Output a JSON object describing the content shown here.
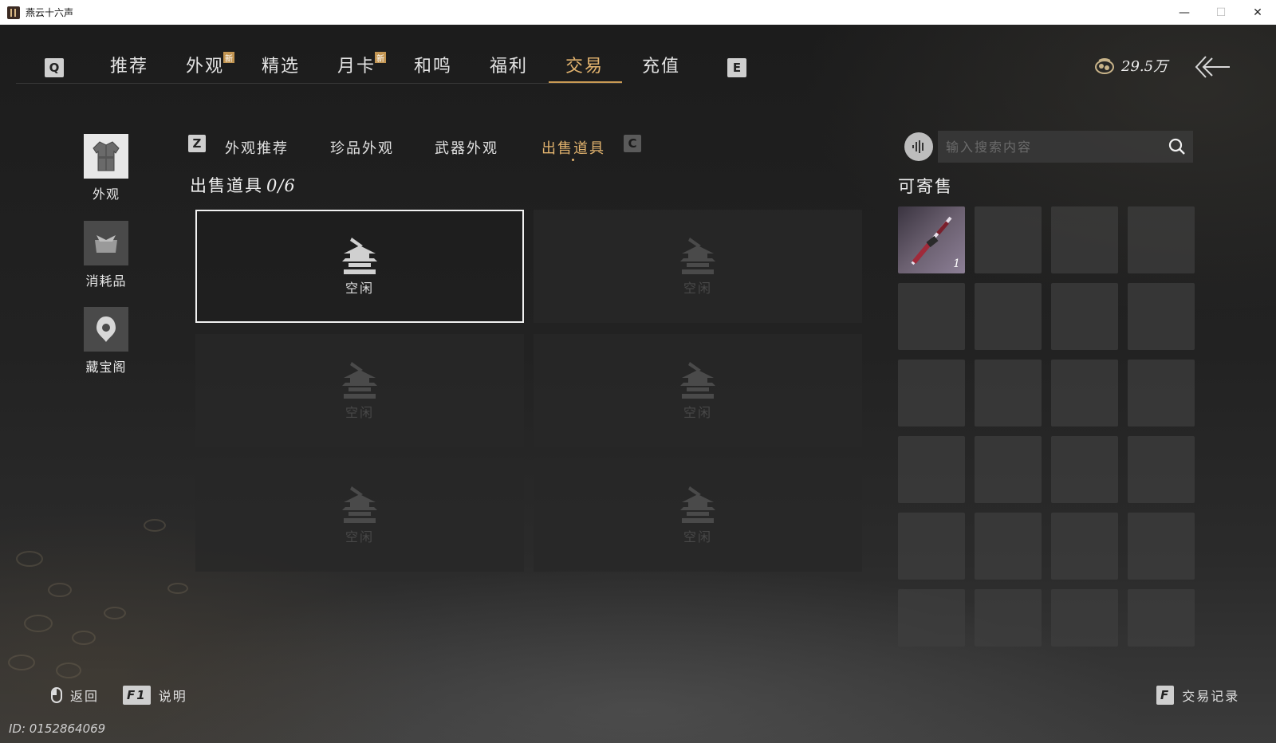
{
  "window": {
    "title": "燕云十六声",
    "minimize": "—",
    "maximize": "☐",
    "close": "✕"
  },
  "topnav": {
    "left_key": "Q",
    "right_key": "E",
    "tabs": [
      {
        "label": "推荐",
        "badge": ""
      },
      {
        "label": "外观",
        "badge": "新"
      },
      {
        "label": "精选",
        "badge": ""
      },
      {
        "label": "月卡",
        "badge": "新"
      },
      {
        "label": "和鸣",
        "badge": ""
      },
      {
        "label": "福利",
        "badge": ""
      },
      {
        "label": "交易",
        "badge": ""
      },
      {
        "label": "充值",
        "badge": ""
      }
    ],
    "active_tab": "交易",
    "currency": "29.5万",
    "accent_color": "#e2b36e"
  },
  "sidenav": {
    "items": [
      {
        "label": "外观",
        "icon": "robe-icon"
      },
      {
        "label": "消耗品",
        "icon": "pouch-icon"
      },
      {
        "label": "藏宝阁",
        "icon": "treasure-icon"
      }
    ],
    "active_item": "外观"
  },
  "subtabs": {
    "left_key": "Z",
    "right_key": "C",
    "items": [
      "外观推荐",
      "珍品外观",
      "武器外观",
      "出售道具"
    ],
    "active": "出售道具"
  },
  "sale": {
    "title": "出售道具",
    "count": "0/6",
    "slot_label": "空闲",
    "slots": [
      "空闲",
      "空闲",
      "空闲",
      "空闲",
      "空闲",
      "空闲"
    ]
  },
  "search": {
    "placeholder": "输入搜索内容",
    "value": ""
  },
  "consign": {
    "title": "可寄售",
    "items": [
      {
        "name": "weapon-item",
        "qty": "1"
      }
    ]
  },
  "footer": {
    "back_label": "返回",
    "help_key": "F1",
    "help_label": "说明",
    "record_key": "F",
    "record_label": "交易记录",
    "user_id": "ID: 0152864069"
  }
}
